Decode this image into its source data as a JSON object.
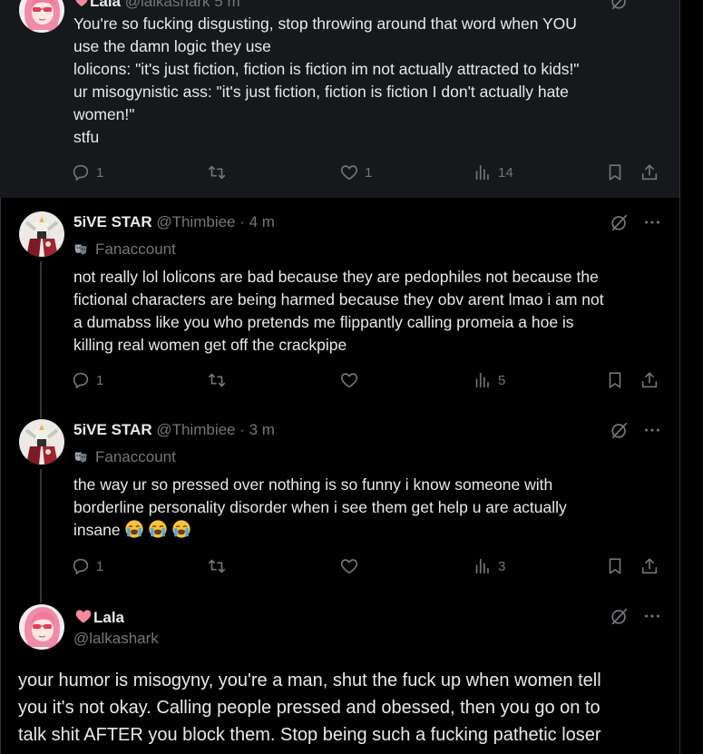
{
  "posts": [
    {
      "name": "Lala",
      "handle": "@lalkashark",
      "time": "5 m",
      "lines": [
        "You're so fucking disgusting, stop throwing around that word when YOU",
        "use the damn logic they use",
        "lolicons: \"it's just fiction, fiction is fiction im not actually attracted to kids!\"",
        "ur misogynistic ass: \"it's just fiction, fiction is fiction I don't actually hate",
        "women!\"",
        "stfu"
      ],
      "replies": "1",
      "reposts": "",
      "likes": "1",
      "views": "14"
    },
    {
      "name": "5iVE STAR",
      "handle": "@Thimbiee",
      "time": "· 4 m",
      "badge": "Fanaccount",
      "lines": [
        "not really lol lolicons are bad because they are pedophiles not because the",
        "fictional characters are being harmed because they obv arent lmao i am not",
        "a dumabss like you who pretends me flippantly calling promeia a hoe is",
        "killing real women get off the crackpipe"
      ],
      "replies": "1",
      "reposts": "",
      "likes": "",
      "views": "5"
    },
    {
      "name": "5iVE STAR",
      "handle": "@Thimbiee",
      "time": "· 3 m",
      "badge": "Fanaccount",
      "lines": [
        "the way ur so pressed over nothing is so funny i know someone with",
        "borderline personality disorder when i see them get help u are actually",
        "insane"
      ],
      "emojis": [
        "loudly-crying-face",
        "loudly-crying-face",
        "loudly-crying-face"
      ],
      "replies": "1",
      "reposts": "",
      "likes": "",
      "views": "3"
    },
    {
      "name": "Lala",
      "handle": "@lalkashark",
      "lines": [
        "your humor is misogyny, you're a man, shut the fuck up when women tell",
        "you it's not okay. Calling people pressed and obessed, then you go on to",
        "talk shit AFTER you block them. Stop being such a fucking pathetic loser"
      ]
    }
  ],
  "colors": {
    "background": "#000000",
    "highlight_bg": "#16181c",
    "text": "#e7e9ea",
    "muted": "#71767b",
    "heart": "#f4899c"
  },
  "icons": [
    "reply-icon",
    "repost-icon",
    "like-icon",
    "views-icon",
    "bookmark-icon",
    "share-icon",
    "grok-icon",
    "more-icon",
    "heart-emoji-icon",
    "theater-mask-icon"
  ]
}
